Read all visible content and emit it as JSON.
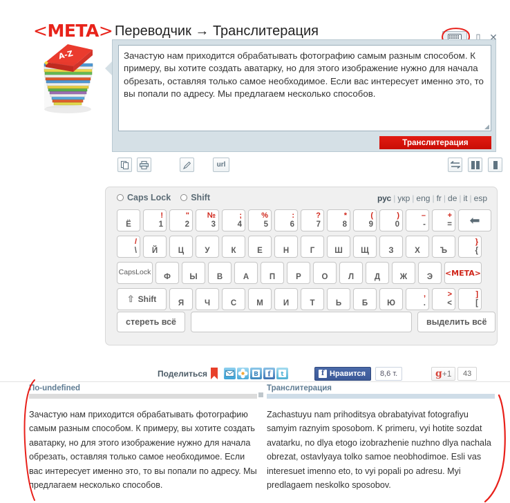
{
  "header": {
    "logo_open": "<",
    "logo_text": "META",
    "logo_close": ">",
    "title": "Переводчик → Транслитерация"
  },
  "books_icon": {
    "label": "A-Z",
    "name": "book-stack-icon"
  },
  "window_controls": {
    "keyboard_icon": "keyboard-icon",
    "restore_icon": "▯",
    "close_icon": "✕"
  },
  "input_panel": {
    "source_text": "Зачастую нам приходится обрабатывать фотографию самым разным способом. К примеру, вы хотите создать аватарку, но для этого изображение нужно для начала обрезать, оставляя только самое необходимое. Если вас интересует именно это, то вы попали по адресу. Мы предлагаем несколько способов.",
    "placeholder": "",
    "translit_button": "Транслитерация"
  },
  "toolbar": {
    "copy": "⧉",
    "print": "⎙",
    "edit": "✎",
    "url": "url",
    "swap": "⇄",
    "two_column": "▮▮",
    "one_column": "▮"
  },
  "keyboard": {
    "caps_lock_label": "Caps Lock",
    "shift_label": "Shift",
    "languages": [
      {
        "code": "рус",
        "active": true
      },
      {
        "code": "укр",
        "active": false
      },
      {
        "code": "eng",
        "active": false
      },
      {
        "code": "fr",
        "active": false
      },
      {
        "code": "de",
        "active": false
      },
      {
        "code": "it",
        "active": false
      },
      {
        "code": "esp",
        "active": false
      }
    ],
    "row1": [
      {
        "sup": "",
        "main": "Ё"
      },
      {
        "sup": "!",
        "main": "1"
      },
      {
        "sup": "\"",
        "main": "2"
      },
      {
        "sup": "№",
        "main": "3"
      },
      {
        "sup": ";",
        "main": "4"
      },
      {
        "sup": "%",
        "main": "5"
      },
      {
        "sup": ":",
        "main": "6"
      },
      {
        "sup": "?",
        "main": "7"
      },
      {
        "sup": "*",
        "main": "8"
      },
      {
        "sup": "(",
        "main": "9"
      },
      {
        "sup": ")",
        "main": "0"
      },
      {
        "sup": "–",
        "main": "-"
      },
      {
        "sup": "+",
        "main": "="
      }
    ],
    "backspace": "⬅",
    "row2": [
      {
        "sup": "/",
        "main": "\\"
      },
      {
        "sup": "",
        "main": "Й"
      },
      {
        "sup": "",
        "main": "Ц"
      },
      {
        "sup": "",
        "main": "У"
      },
      {
        "sup": "",
        "main": "К"
      },
      {
        "sup": "",
        "main": "Е"
      },
      {
        "sup": "",
        "main": "Н"
      },
      {
        "sup": "",
        "main": "Г"
      },
      {
        "sup": "",
        "main": "Ш"
      },
      {
        "sup": "",
        "main": "Щ"
      },
      {
        "sup": "",
        "main": "З"
      },
      {
        "sup": "",
        "main": "Х"
      },
      {
        "sup": "",
        "main": "Ъ"
      },
      {
        "sup": "}",
        "main": "{"
      }
    ],
    "caps_key": "Caps\nLock",
    "caps_key_line1": "Caps",
    "caps_key_line2": "Lock",
    "row3": [
      {
        "sup": "",
        "main": "Ф"
      },
      {
        "sup": "",
        "main": "Ы"
      },
      {
        "sup": "",
        "main": "В"
      },
      {
        "sup": "",
        "main": "А"
      },
      {
        "sup": "",
        "main": "П"
      },
      {
        "sup": "",
        "main": "Р"
      },
      {
        "sup": "",
        "main": "О"
      },
      {
        "sup": "",
        "main": "Л"
      },
      {
        "sup": "",
        "main": "Д"
      },
      {
        "sup": "",
        "main": "Ж"
      },
      {
        "sup": "",
        "main": "Э"
      }
    ],
    "meta_key": "<META>",
    "shift_key": "Shift",
    "row4": [
      {
        "sup": "",
        "main": "Я"
      },
      {
        "sup": "",
        "main": "Ч"
      },
      {
        "sup": "",
        "main": "С"
      },
      {
        "sup": "",
        "main": "М"
      },
      {
        "sup": "",
        "main": "И"
      },
      {
        "sup": "",
        "main": "Т"
      },
      {
        "sup": "",
        "main": "Ь"
      },
      {
        "sup": "",
        "main": "Б"
      },
      {
        "sup": "",
        "main": "Ю"
      },
      {
        "sup": ",",
        "main": "."
      },
      {
        "sup": ">",
        "main": "<"
      },
      {
        "sup": "]",
        "main": "["
      }
    ],
    "clear_all": "стереть всё",
    "select_all": "выделить всё"
  },
  "share": {
    "label": "Поделиться",
    "icons": [
      "bookmark-icon",
      "mail-icon",
      "odnoklassniki-icon",
      "vkontakte-icon",
      "facebook-icon",
      "twitter-icon"
    ],
    "fb_like": "Нравится",
    "fb_count": "8,6 т.",
    "gplus_g": "g",
    "gplus_plus": "+1",
    "gplus_count": "43"
  },
  "results": {
    "left": {
      "title": "По-undefined",
      "text": "Зачастую нам приходится обрабатывать фотографию самым разным способом. К примеру, вы хотите создать аватарку, но для этого изображение нужно для начала обрезать, оставляя только самое необходимое. Если вас интересует именно это, то вы попали по адресу. Мы предлагаем несколько способов."
    },
    "right": {
      "title": "Транслитерация",
      "text": "Zachastuyu nam prihoditsya obrabatyivat fotografiyu samyim raznyim sposobom. K primeru, vyi hotite sozdat avatarku, no dlya etogo izobrazhenie nuzhno dlya nachala obrezat, ostavlyaya tolko samoe neobhodimoe. Esli vas interesuet imenno eto, to vyi popali po adresu. Myi predlagaem neskolko sposobov."
    }
  },
  "colors": {
    "brand_red": "#E8231A",
    "panel_blue": "#d5e0e6",
    "title_blue": "#5f7c93",
    "annotation_red": "#e8201a"
  }
}
